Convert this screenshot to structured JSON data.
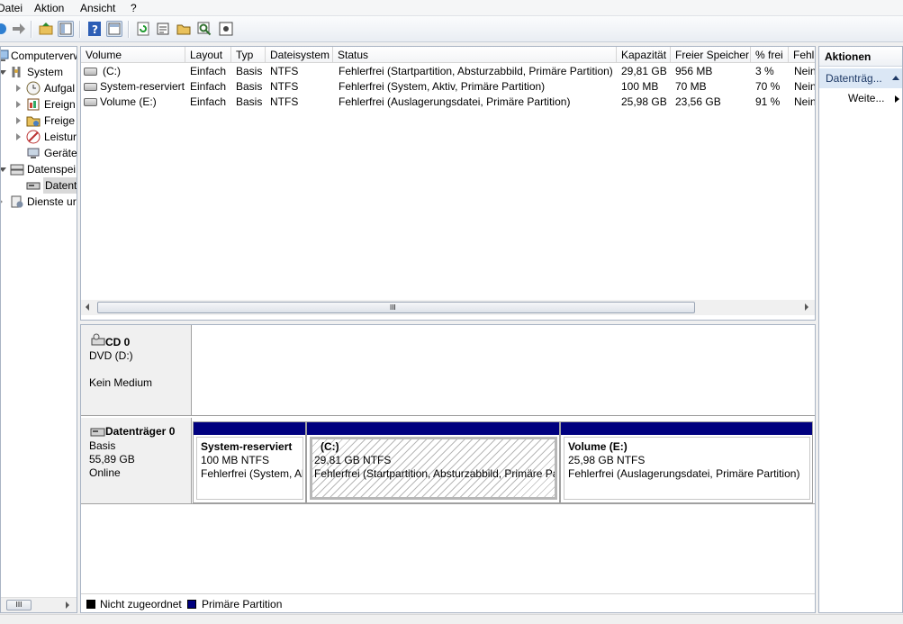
{
  "menu": [
    "Datei",
    "Aktion",
    "Ansicht",
    "?"
  ],
  "tree": {
    "items": [
      {
        "label": "Computerverw",
        "icon": "computer-management-icon",
        "level": 0
      },
      {
        "label": "System",
        "icon": "system-tools-icon",
        "level": 1
      },
      {
        "label": "Aufgal",
        "icon": "task-scheduler-icon",
        "level": 2
      },
      {
        "label": "Ereign",
        "icon": "event-viewer-icon",
        "level": 2
      },
      {
        "label": "Freige",
        "icon": "shared-folders-icon",
        "level": 2
      },
      {
        "label": "Leistur",
        "icon": "performance-icon",
        "level": 2
      },
      {
        "label": "Geräte",
        "icon": "device-manager-icon",
        "level": 2
      },
      {
        "label": "Datenspei",
        "icon": "storage-icon",
        "level": 1
      },
      {
        "label": "Datent",
        "icon": "disk-management-icon",
        "level": 2
      },
      {
        "label": "Dienste ur",
        "icon": "services-icon",
        "level": 1
      }
    ]
  },
  "volume_list": {
    "columns": [
      "Volume",
      "Layout",
      "Typ",
      "Dateisystem",
      "Status",
      "Kapazität",
      "Freier Speicher",
      "% frei",
      "Fehl"
    ],
    "rows": [
      [
        "(C:)",
        "Einfach",
        "Basis",
        "NTFS",
        "Fehlerfrei (Startpartition, Absturzabbild, Primäre Partition)",
        "29,81 GB",
        "956 MB",
        "3 %",
        "Nein"
      ],
      [
        "System-reserviert",
        "Einfach",
        "Basis",
        "NTFS",
        "Fehlerfrei (System, Aktiv, Primäre Partition)",
        "100 MB",
        "70 MB",
        "70 %",
        "Nein"
      ],
      [
        "Volume (E:)",
        "Einfach",
        "Basis",
        "NTFS",
        "Fehlerfrei (Auslagerungsdatei, Primäre Partition)",
        "25,98 GB",
        "23,56 GB",
        "91 %",
        "Nein"
      ]
    ],
    "scroll_grip": "III"
  },
  "disks": [
    {
      "name": "CD 0",
      "line1": "DVD (D:)",
      "line2": "",
      "line3": "Kein Medium",
      "icon": "cd-drive-icon"
    },
    {
      "name": "Datenträger 0",
      "line1": "Basis",
      "line2": "55,89 GB",
      "line3": "Online",
      "icon": "hard-disk-icon",
      "partitions": [
        {
          "name": "System-reserviert",
          "size": "100 MB NTFS",
          "status": "Fehlerfrei (System, Aktiv, Primäre Partition)"
        },
        {
          "name": "(C:)",
          "size": "29,81 GB NTFS",
          "status": "Fehlerfrei (Startpartition, Absturzabbild, Primäre Partition)"
        },
        {
          "name": "Volume  (E:)",
          "size": "25,98 GB NTFS",
          "status": "Fehlerfrei (Auslagerungsdatei, Primäre Partition)"
        }
      ]
    }
  ],
  "legend": [
    {
      "label": "Nicht zugeordnet",
      "color": "#000000"
    },
    {
      "label": "Primäre Partition",
      "color": "#00007f"
    }
  ],
  "actions": {
    "title": "Aktionen",
    "section": "Datenträg...",
    "more": "Weite..."
  },
  "colors": {
    "partition_bar": "#00007f",
    "selection": "#dbe7f5"
  }
}
